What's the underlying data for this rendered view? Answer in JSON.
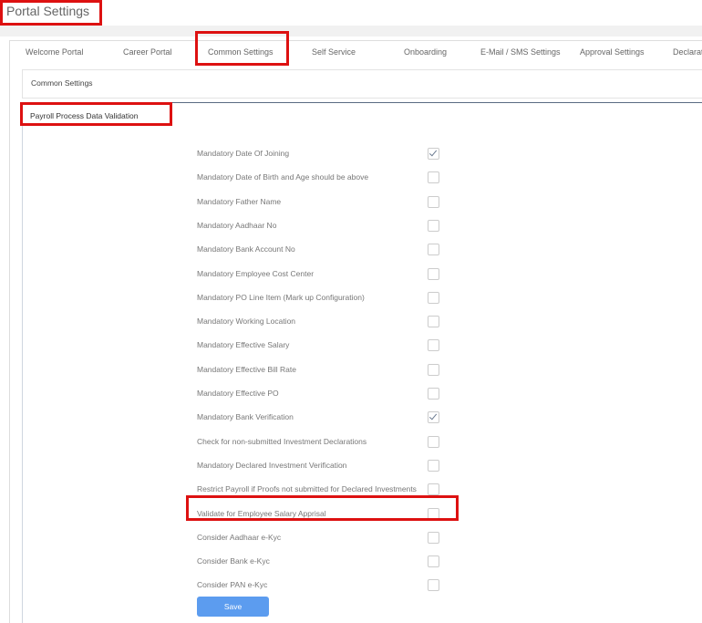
{
  "page_title": "Portal Settings",
  "tabs": [
    "Welcome Portal",
    "Career Portal",
    "Common Settings",
    "Self Service",
    "Onboarding",
    "E-Mail / SMS Settings",
    "Approval Settings",
    "Declarati"
  ],
  "active_tab": "Common Settings",
  "panel_title": "Common Settings",
  "section_title": "Payroll Process Data Validation",
  "options": [
    {
      "label": "Mandatory Date Of Joining",
      "checked": true
    },
    {
      "label": "Mandatory Date of Birth and Age should be above",
      "checked": false
    },
    {
      "label": "Mandatory Father Name",
      "checked": false
    },
    {
      "label": "Mandatory Aadhaar No",
      "checked": false
    },
    {
      "label": "Mandatory Bank Account No",
      "checked": false
    },
    {
      "label": "Mandatory Employee Cost Center",
      "checked": false
    },
    {
      "label": "Mandatory PO Line Item (Mark up Configuration)",
      "checked": false
    },
    {
      "label": "Mandatory Working Location",
      "checked": false
    },
    {
      "label": "Mandatory Effective Salary",
      "checked": false
    },
    {
      "label": "Mandatory Effective Bill Rate",
      "checked": false
    },
    {
      "label": "Mandatory Effective PO",
      "checked": false
    },
    {
      "label": "Mandatory Bank Verification",
      "checked": true
    },
    {
      "label": "Check for non-submitted Investment Declarations",
      "checked": false
    },
    {
      "label": "Mandatory Declared Investment Verification",
      "checked": false
    },
    {
      "label": "Restrict Payroll if Proofs not submitted for Declared Investments",
      "checked": false
    },
    {
      "label": "Validate for Employee Salary Apprisal",
      "checked": false
    },
    {
      "label": "Consider Aadhaar e-Kyc",
      "checked": false
    },
    {
      "label": "Consider Bank e-Kyc",
      "checked": false
    },
    {
      "label": "Consider PAN e-Kyc",
      "checked": false
    }
  ],
  "save_label": "Save",
  "colors": {
    "highlight": "#dd1111",
    "button": "#5c9cef"
  }
}
